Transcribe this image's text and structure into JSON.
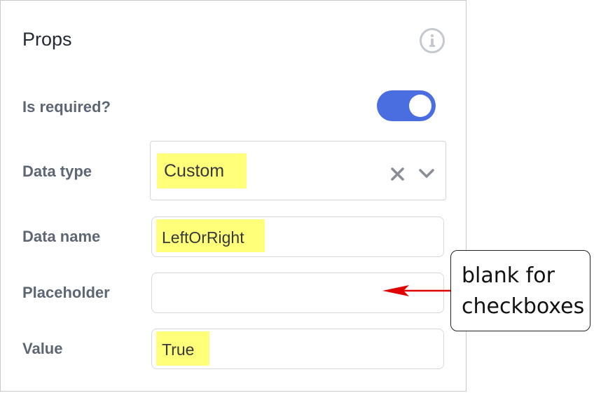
{
  "panel": {
    "title": "Props",
    "info_icon": "info-icon"
  },
  "fields": {
    "is_required": {
      "label": "Is required?",
      "toggle_on": true,
      "accent": "#4a6ee0"
    },
    "data_type": {
      "label": "Data type",
      "value": "Custom",
      "clear_icon": "close-icon",
      "dropdown_icon": "chevron-down-icon"
    },
    "data_name": {
      "label": "Data name",
      "value": "LeftOrRight"
    },
    "placeholder": {
      "label": "Placeholder",
      "value": ""
    },
    "value": {
      "label": "Value",
      "value": "True"
    }
  },
  "annotation": {
    "line1": "blank for",
    "line2": "checkboxes",
    "arrow_color": "#e00000",
    "highlight_color": "#ffff7a"
  }
}
